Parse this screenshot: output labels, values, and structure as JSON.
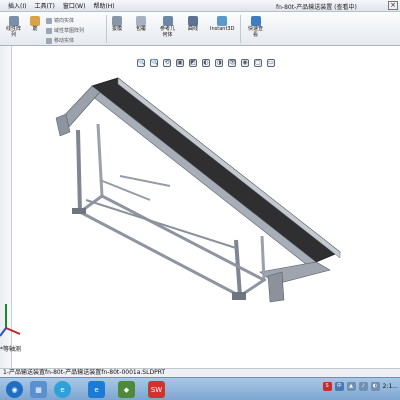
{
  "menubar": {
    "items": [
      "插入(I)",
      "工具(T)",
      "窗口(W)",
      "帮助(H)"
    ],
    "doc_title": "fn-80t-产品输送装置 (查看中)",
    "close": "×"
  },
  "toolbar": {
    "buttons": [
      {
        "label": "线性阵\n列"
      },
      {
        "label": "筋"
      },
      {
        "label": "拔模"
      },
      {
        "label": "包覆"
      },
      {
        "label": "参考几\n何体"
      },
      {
        "label": "曲线"
      },
      {
        "label": "Instant3D"
      },
      {
        "label": "快速\n视图"
      }
    ],
    "rows": [
      "镜向实体",
      "域性草图阵列",
      "移动实体"
    ],
    "express_view_label": "快速查\n看"
  },
  "heads_up_toolbar": [
    "🔍",
    "🔍",
    "⟲",
    "▣",
    "◩",
    "◐",
    "◑",
    "👁",
    "◉",
    "▢",
    "▭"
  ],
  "triad": {
    "label": "*等轴测"
  },
  "statusbar": {
    "text": "1-产品输送装置fn-80t-产品输送装置fn-80t-0001a.SLDPRT"
  },
  "taskbar": {
    "icons": [
      "◉",
      "▦",
      "e",
      "◆",
      "SW"
    ],
    "tray": [
      "S",
      "中",
      "▲",
      "♪",
      "◐"
    ],
    "clock": "2:1..."
  },
  "colors": {
    "frame": "#8e96a2",
    "belt": "#2e2e2e",
    "toolbar_bg": "#eef1f5"
  }
}
